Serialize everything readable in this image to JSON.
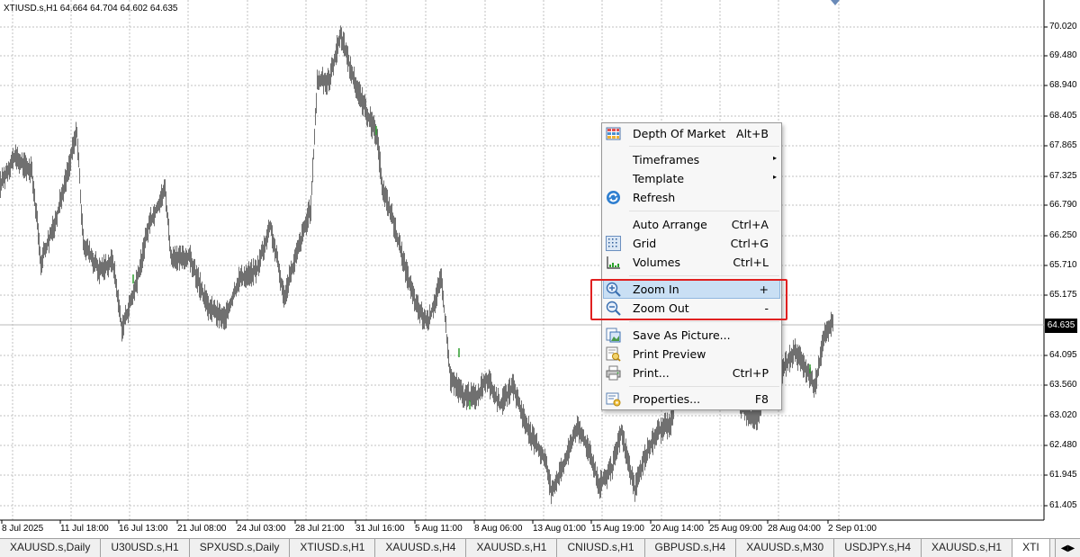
{
  "chart": {
    "info": "XTIUSD.s,H1  64.664 64.704 64.602 64.635",
    "current_price": "64.635",
    "price_labels": [
      "70.020",
      "69.480",
      "68.940",
      "68.405",
      "67.865",
      "67.325",
      "66.790",
      "66.250",
      "65.710",
      "65.175",
      "64.095",
      "63.560",
      "63.020",
      "62.480",
      "61.945",
      "61.405"
    ],
    "time_labels": [
      "8 Jul 2025",
      "11 Jul 18:00",
      "16 Jul 13:00",
      "21 Jul 08:00",
      "24 Jul 03:00",
      "28 Jul 21:00",
      "31 Jul 16:00",
      "5 Aug 11:00",
      "8 Aug 06:00",
      "13 Aug 01:00",
      "15 Aug 19:00",
      "20 Aug 14:00",
      "25 Aug 09:00",
      "28 Aug 04:00",
      "2 Sep 01:00"
    ],
    "colors": {
      "line": "#707070",
      "up_tick": "#2e9e2e",
      "grid": "#c0c0c0",
      "current_line": "#b8b8b8"
    }
  },
  "context_menu": {
    "items": [
      {
        "label": "Depth Of Market",
        "shortcut": "Alt+B",
        "icon": "depth-of-market-icon"
      },
      {
        "label": "Timeframes",
        "submenu": true
      },
      {
        "label": "Template",
        "submenu": true
      },
      {
        "label": "Refresh",
        "icon": "refresh-icon"
      },
      {
        "label": "Auto Arrange",
        "shortcut": "Ctrl+A"
      },
      {
        "label": "Grid",
        "shortcut": "Ctrl+G",
        "icon": "grid-icon"
      },
      {
        "label": "Volumes",
        "shortcut": "Ctrl+L",
        "icon": "volumes-icon"
      },
      {
        "label": "Zoom In",
        "shortcut": "+",
        "icon": "zoom-in-icon",
        "highlighted": true
      },
      {
        "label": "Zoom Out",
        "shortcut": "-",
        "icon": "zoom-out-icon"
      },
      {
        "label": "Save As Picture...",
        "icon": "save-picture-icon"
      },
      {
        "label": "Print Preview",
        "icon": "print-preview-icon"
      },
      {
        "label": "Print...",
        "shortcut": "Ctrl+P",
        "icon": "printer-icon"
      },
      {
        "label": "Properties...",
        "shortcut": "F8",
        "icon": "properties-icon"
      }
    ],
    "submenu_arrow": "▸"
  },
  "tabs": [
    {
      "label": "XAUUSD.s,Daily"
    },
    {
      "label": "U30USD.s,H1"
    },
    {
      "label": "SPXUSD.s,Daily"
    },
    {
      "label": "XTIUSD.s,H1"
    },
    {
      "label": "XAUUSD.s,H4"
    },
    {
      "label": "XAUUSD.s,H1"
    },
    {
      "label": "CNIUSD.s,H1"
    },
    {
      "label": "GBPUSD.s,H4"
    },
    {
      "label": "XAUUSD.s,M30"
    },
    {
      "label": "USDJPY.s,H4"
    },
    {
      "label": "XAUUSD.s,H1"
    },
    {
      "label": "XTI",
      "active": true
    }
  ],
  "tab_scroll": {
    "left": "◀",
    "right": "▶"
  }
}
